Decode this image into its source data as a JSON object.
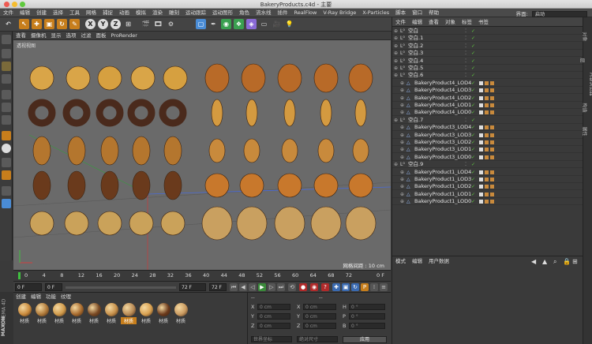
{
  "window": {
    "title": "BakeryProducts.c4d - 主要"
  },
  "menu": [
    "文件",
    "编辑",
    "创建",
    "选择",
    "工具",
    "网格",
    "捕捉",
    "动画",
    "模拟",
    "渲染",
    "雕刻",
    "运动跟踪",
    "运动图形",
    "角色",
    "流水线",
    "插件",
    "RealFlow",
    "V-Ray Bridge",
    "X-Particles",
    "脚本",
    "窗口",
    "帮助"
  ],
  "layout": {
    "label": "界面:",
    "value": "启动"
  },
  "toolbar": {
    "x": "X",
    "y": "Y",
    "z": "Z"
  },
  "viewport": {
    "menu": [
      "查看",
      "摄像机",
      "显示",
      "选项",
      "过滤",
      "面板",
      "ProRender"
    ],
    "label": "透视视图",
    "grid_info": "网格间距 : 10 cm"
  },
  "timeline": {
    "ticks": [
      "0",
      "4",
      "8",
      "12",
      "16",
      "20",
      "24",
      "28",
      "32",
      "36",
      "40",
      "44",
      "48",
      "52",
      "56",
      "60",
      "64",
      "68",
      "72"
    ],
    "end_marker": "0 F"
  },
  "transport": {
    "start": "0 F",
    "current": "0 F",
    "end": "72 F",
    "end2": "72 F"
  },
  "materials": {
    "menu": [
      "创建",
      "编辑",
      "功能",
      "纹理"
    ],
    "items": [
      "材质",
      "材质",
      "材质",
      "材质",
      "材质",
      "材质",
      "材质",
      "材质",
      "材质",
      "材质"
    ],
    "colors": [
      "#c98a3c",
      "#b07a3a",
      "#d09a4a",
      "#a86b2e",
      "#7a4a24",
      "#c58f4a",
      "#b88a55",
      "#d8a050",
      "#6b3a1c",
      "#c99a60"
    ],
    "brand": [
      "MAXON",
      "CINEMA 4D"
    ]
  },
  "coords": {
    "header": "--",
    "header2": "--",
    "rows": [
      {
        "axis": "X",
        "pos": "0 cm",
        "axis2": "X",
        "size": "0 cm",
        "rot_axis": "H",
        "rot": "0 °"
      },
      {
        "axis": "Y",
        "pos": "0 cm",
        "axis2": "Y",
        "size": "0 cm",
        "rot_axis": "P",
        "rot": "0 °"
      },
      {
        "axis": "Z",
        "pos": "0 cm",
        "axis2": "Z",
        "size": "0 cm",
        "rot_axis": "B",
        "rot": "0 °"
      }
    ],
    "world": "世界坐标",
    "scale": "绝对尺寸",
    "apply": "应用"
  },
  "object_manager": {
    "menu": [
      "文件",
      "编辑",
      "查看",
      "对象",
      "标签",
      "书签"
    ],
    "rows": [
      {
        "name": "空白",
        "indent": 0,
        "lod": false
      },
      {
        "name": "空白.1",
        "indent": 0,
        "lod": false
      },
      {
        "name": "空白.2",
        "indent": 0,
        "lod": false
      },
      {
        "name": "空白.3",
        "indent": 0,
        "lod": false
      },
      {
        "name": "空白.4",
        "indent": 0,
        "lod": false
      },
      {
        "name": "空白.5",
        "indent": 0,
        "lod": false
      },
      {
        "name": "空白.6",
        "indent": 0,
        "lod": false
      },
      {
        "name": "BakeryProduct4_LOD4",
        "indent": 1,
        "lod": true
      },
      {
        "name": "BakeryProduct4_LOD3",
        "indent": 1,
        "lod": true
      },
      {
        "name": "BakeryProduct4_LOD2",
        "indent": 1,
        "lod": true
      },
      {
        "name": "BakeryProduct4_LOD1",
        "indent": 1,
        "lod": true
      },
      {
        "name": "BakeryProduct4_LOD0",
        "indent": 1,
        "lod": true
      },
      {
        "name": "空白.7",
        "indent": 0,
        "lod": false
      },
      {
        "name": "BakeryProduct3_LOD4",
        "indent": 1,
        "lod": true
      },
      {
        "name": "BakeryProduct3_LOD3",
        "indent": 1,
        "lod": true
      },
      {
        "name": "BakeryProduct3_LOD2",
        "indent": 1,
        "lod": true
      },
      {
        "name": "BakeryProduct3_LOD1",
        "indent": 1,
        "lod": true
      },
      {
        "name": "BakeryProduct3_LOD0",
        "indent": 1,
        "lod": true
      },
      {
        "name": "空白.9",
        "indent": 0,
        "lod": false
      },
      {
        "name": "BakeryProduct1_LOD4",
        "indent": 1,
        "lod": true
      },
      {
        "name": "BakeryProduct1_LOD3",
        "indent": 1,
        "lod": true
      },
      {
        "name": "BakeryProduct1_LOD2",
        "indent": 1,
        "lod": true
      },
      {
        "name": "BakeryProduct1_LOD1",
        "indent": 1,
        "lod": true
      },
      {
        "name": "BakeryProduct1_LOD0",
        "indent": 1,
        "lod": true
      }
    ]
  },
  "attribute_manager": {
    "menu": [
      "模式",
      "编辑",
      "用户数据"
    ]
  },
  "side_tabs": [
    "对象",
    "层",
    "内容浏览器",
    "构造",
    "属性"
  ]
}
